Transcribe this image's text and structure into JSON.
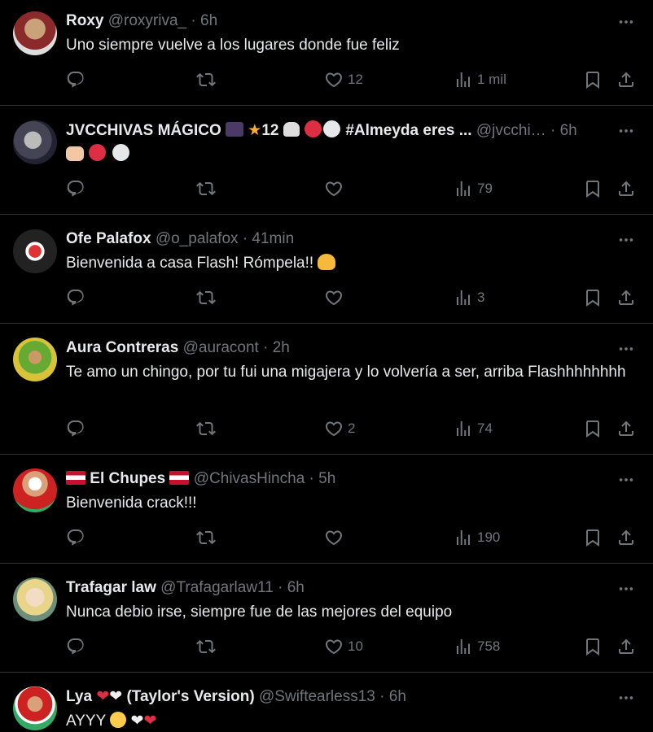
{
  "colors": {
    "background": "#000000",
    "text": "#e7e9ea",
    "muted": "#71767b",
    "divider": "#2f3336",
    "red": "#dd2e44"
  },
  "tweets": [
    {
      "name": "Roxy",
      "handle": "@roxyriva_",
      "time": "6h",
      "text": "Uno siempre vuelve a los lugares donde fue feliz",
      "likes": "12",
      "views": "1 mil"
    },
    {
      "name": "JVCCHIVAS MÁGICO",
      "name_suffix": "12",
      "name_tail": "#Almeyda eres ...",
      "handle": "@jvcchi…",
      "time": "6h",
      "text": "",
      "likes": "",
      "views": "79"
    },
    {
      "name": "Ofe Palafox",
      "handle": "@o_palafox",
      "time": "41min",
      "text": "Bienvenida a casa Flash! Rómpela!!",
      "likes": "",
      "views": "3"
    },
    {
      "name": "Aura Contreras",
      "handle": "@auracont",
      "time": "2h",
      "text": "Te amo un chingo, por tu fui una migajera y lo volvería a ser, arriba Flashhhhhhhh",
      "likes": "2",
      "views": "74"
    },
    {
      "name": "El Chupes",
      "handle": "@ChivasHincha",
      "time": "5h",
      "text": "Bienvenida crack!!!",
      "likes": "",
      "views": "190"
    },
    {
      "name": "Trafagar law",
      "handle": "@Trafagarlaw11",
      "time": "6h",
      "text": "Nunca debio irse, siempre fue de las mejores del equipo",
      "likes": "10",
      "views": "758"
    },
    {
      "name": "Lya",
      "name_tail": "(Taylor's Version)",
      "handle": "@Swiftearless13",
      "time": "6h",
      "text": "AYYY",
      "likes": "",
      "views": ""
    }
  ],
  "separator": "·",
  "icons": {
    "reply": "reply-icon",
    "retweet": "retweet-icon",
    "like": "heart-icon",
    "views": "views-icon",
    "bookmark": "bookmark-icon",
    "share": "share-icon",
    "more": "more-icon"
  }
}
